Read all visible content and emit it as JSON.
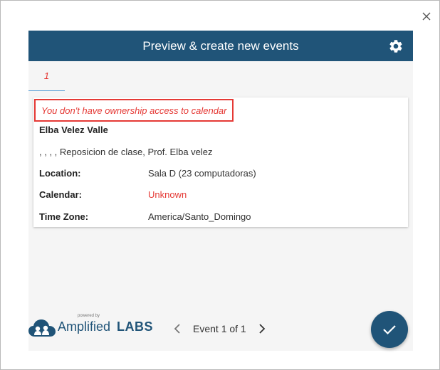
{
  "dialog": {
    "title": "Preview & create new events"
  },
  "tabs": [
    {
      "label": "1",
      "active": true
    }
  ],
  "event": {
    "warning": "You don't have ownership access to calendar",
    "title": "Elba Velez Valle",
    "description": ", , , , Reposicion de clase, Prof. Elba velez",
    "fields": [
      {
        "label": "Location:",
        "value": "Sala D (23 computadoras)"
      },
      {
        "label": "Calendar:",
        "value": "Unknown"
      },
      {
        "label": "Time Zone:",
        "value": "America/Santo_Domingo"
      }
    ]
  },
  "footer": {
    "powered_by": "powered by",
    "brand_name": "Amplified",
    "brand_suffix": "LABS",
    "pager_text": "Event 1 of 1"
  },
  "icons": {
    "close": "close-icon",
    "settings": "gear-icon",
    "prev": "chevron-left-icon",
    "next": "chevron-right-icon",
    "confirm": "check-icon",
    "logo": "cloud-logo-icon"
  },
  "colors": {
    "header": "#205478",
    "error": "#e53935",
    "tab_indicator": "#5aa0d6",
    "panel_bg": "#f5f5f5"
  }
}
